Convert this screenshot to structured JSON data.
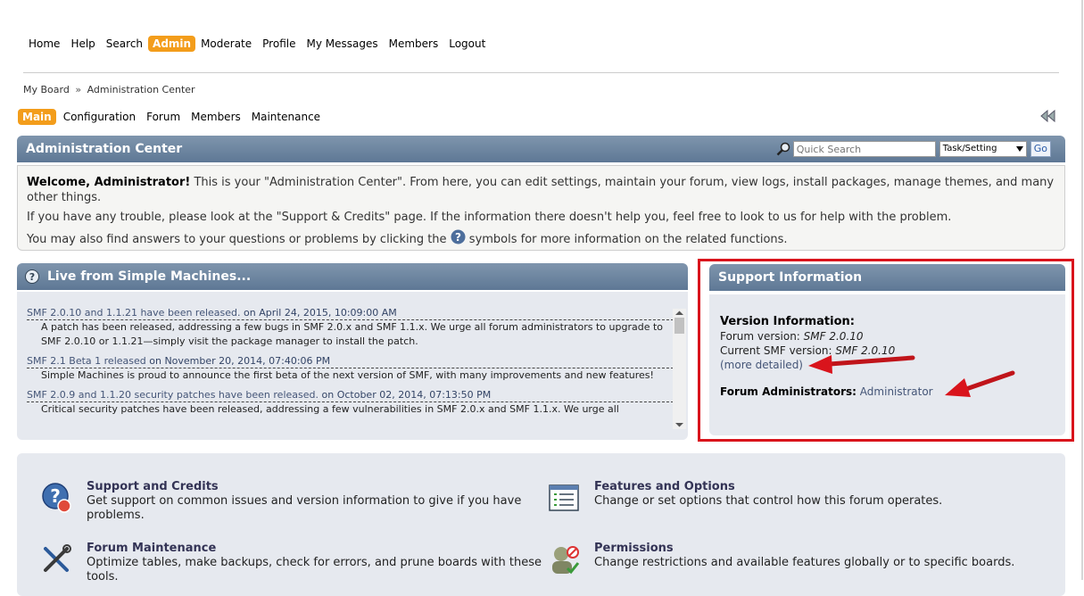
{
  "top_menu": [
    "Home",
    "Help",
    "Search",
    "Admin",
    "Moderate",
    "Profile",
    "My Messages",
    "Members",
    "Logout"
  ],
  "breadcrumb": {
    "board": "My Board",
    "separator": "»",
    "current": "Administration Center"
  },
  "sub_menu": [
    "Main",
    "Configuration",
    "Forum",
    "Members",
    "Maintenance"
  ],
  "admin_center": {
    "title": "Administration Center",
    "search_placeholder": "Quick Search",
    "select_value": "Task/Setting",
    "go_label": "Go"
  },
  "welcome": {
    "bold": "Welcome, Administrator!",
    "line1": " This is your \"Administration Center\". From here, you can edit settings, maintain your forum, view logs, install packages, manage themes, and many other things.",
    "line2": "If you have any trouble, please look at the \"Support & Credits\" page. If the information there doesn't help you, feel free to look to us for help with the problem.",
    "line3a": "You may also find answers to your questions or problems by clicking the ",
    "line3b": " symbols for more information on the related functions."
  },
  "live": {
    "title": "Live from Simple Machines...",
    "news": [
      {
        "title": "SMF 2.0.10 and 1.1.21 have been released.",
        "date": " on April 24, 2015, 10:09:00 AM",
        "body": "A patch has been released, addressing a few bugs in SMF 2.0.x and SMF 1.1.x. We urge all forum administrators to upgrade to SMF 2.0.10 or 1.1.21—simply visit the package manager to install the patch."
      },
      {
        "title": "SMF 2.1 Beta 1 released",
        "date": " on November 20, 2014, 07:40:06 PM",
        "body": "Simple Machines is proud to announce the first beta of the next version of SMF, with many improvements and new features!"
      },
      {
        "title": "SMF 2.0.9 and 1.1.20 security patches have been released.",
        "date": " on October 02, 2014, 07:13:50 PM",
        "body": "Critical security patches have been released, addressing a few vulnerabilities in SMF 2.0.x and SMF 1.1.x. We urge all"
      }
    ]
  },
  "support": {
    "title": "Support Information",
    "version_heading": "Version Information:",
    "forum_version_label": "Forum version: ",
    "forum_version": "SMF 2.0.10",
    "current_version_label": "Current SMF version: ",
    "current_version": "SMF 2.0.10",
    "more_detailed": "(more detailed)",
    "admins_label": "Forum Administrators:",
    "admins_value": " Administrator"
  },
  "sections": [
    {
      "title": "Support and Credits",
      "desc": "Get support on common issues and version information to give if you have problems.",
      "icon": "support-icon"
    },
    {
      "title": "Features and Options",
      "desc": "Change or set options that control how this forum operates.",
      "icon": "features-icon"
    },
    {
      "title": "Forum Maintenance",
      "desc": "Optimize tables, make backups, check for errors, and prune boards with these tools.",
      "icon": "maintenance-icon"
    },
    {
      "title": "Permissions",
      "desc": "Change restrictions and available features globally or to specific boards.",
      "icon": "permissions-icon"
    }
  ],
  "colors": {
    "accent": "#f39d1b",
    "header": "#6a829e",
    "highlight": "#d9141c"
  }
}
